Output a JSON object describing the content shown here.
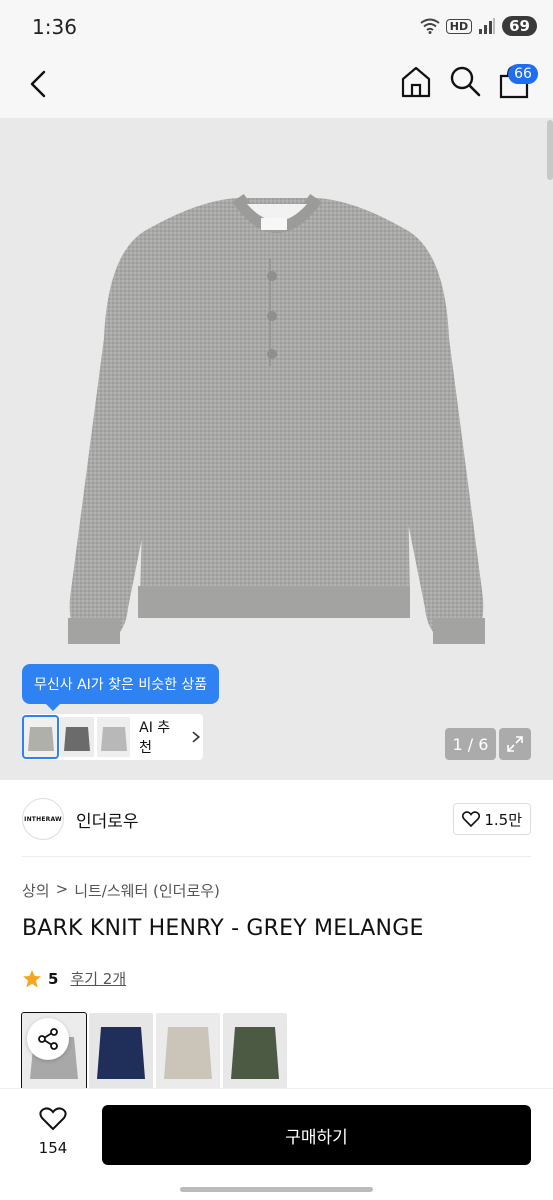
{
  "status_bar": {
    "time": "1:36",
    "network_label": "HD",
    "battery": "69"
  },
  "app_bar": {
    "cart_count": "66"
  },
  "hero": {
    "ai_tooltip": "무신사 AI가 찾은 비슷한 상품",
    "ai_recommend_label": "AI 추천",
    "image_counter": "1 / 6"
  },
  "brand": {
    "logo_text": "INTHERAW",
    "name": "인더로우",
    "likes": "1.5만"
  },
  "breadcrumb": {
    "first": "상의",
    "separator": ">",
    "second": "니트/스웨터 (인더로우)"
  },
  "product": {
    "title": "BARK KNIT HENRY - GREY MELANGE",
    "rating": "5",
    "reviews": "후기 2개"
  },
  "bottom_bar": {
    "wish_count": "154",
    "buy_label": "구매하기"
  },
  "colors": {
    "accent": "#2f82f2",
    "cart_badge": "#1d6ef0",
    "star": "#f5a623",
    "buy_button": "#000000",
    "variant_grey": "#a8a8a8",
    "variant_navy": "#1f2f5a",
    "variant_beige": "#cbc5b9",
    "variant_olive": "#4d5a43"
  }
}
